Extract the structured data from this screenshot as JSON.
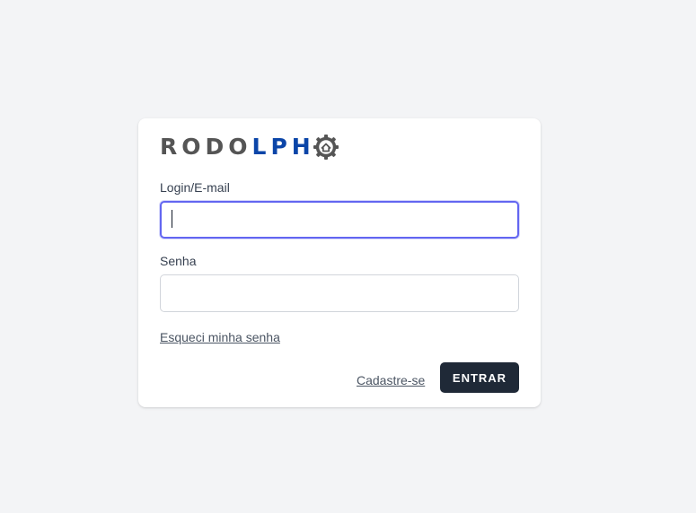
{
  "logo": {
    "part1": "RODO",
    "part2": "LPH",
    "part1_color": "#555555",
    "part2_color": "#0b45a8",
    "icon": "gear-house-icon"
  },
  "login": {
    "label": "Login/E-mail",
    "value": "",
    "placeholder": ""
  },
  "password": {
    "label": "Senha",
    "value": "",
    "placeholder": ""
  },
  "forgot_link": "Esqueci minha senha",
  "register_link": "Cadastre-se",
  "submit_label": "ENTRAR",
  "colors": {
    "background": "#f3f4f6",
    "card": "#ffffff",
    "focus_ring": "#6366f1",
    "button": "#1f2937"
  }
}
